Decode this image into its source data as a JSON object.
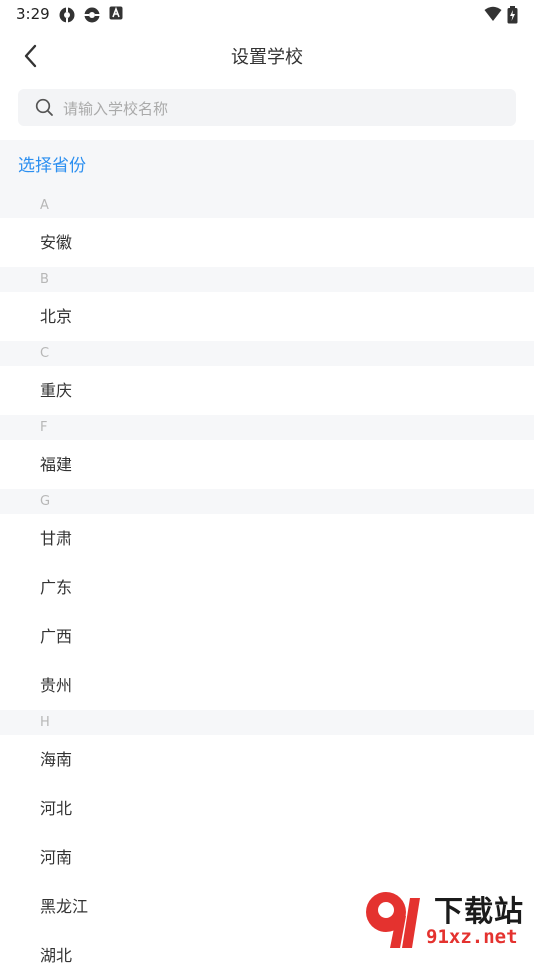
{
  "status_bar": {
    "time": "3:29"
  },
  "header": {
    "title": "设置学校"
  },
  "search": {
    "placeholder": "请输入学校名称"
  },
  "section_title": "选择省份",
  "groups": [
    {
      "letter": "A",
      "items": [
        "安徽"
      ]
    },
    {
      "letter": "B",
      "items": [
        "北京"
      ]
    },
    {
      "letter": "C",
      "items": [
        "重庆"
      ]
    },
    {
      "letter": "F",
      "items": [
        "福建"
      ]
    },
    {
      "letter": "G",
      "items": [
        "甘肃",
        "广东",
        "广西",
        "贵州"
      ]
    },
    {
      "letter": "H",
      "items": [
        "海南",
        "河北",
        "河南",
        "黑龙江",
        "湖北"
      ]
    }
  ],
  "watermark": {
    "title": "下载站",
    "url": "91xz.net",
    "logo_text": "9"
  },
  "colors": {
    "accent": "#2c8ff0",
    "watermark_red": "#e4322f"
  }
}
